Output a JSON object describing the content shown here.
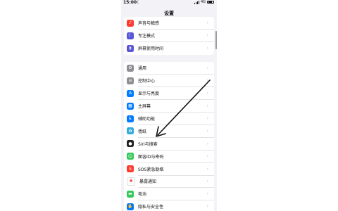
{
  "status_bar": {
    "time": "15:00",
    "network": "4G"
  },
  "nav": {
    "title": "设置"
  },
  "group1": [
    {
      "label": "声音与触感",
      "icon": "speaker-icon",
      "color": "#ff3b30"
    },
    {
      "label": "专注模式",
      "icon": "moon-icon",
      "color": "#5856d6"
    },
    {
      "label": "屏幕使用时间",
      "icon": "hourglass-icon",
      "color": "#5856d6"
    }
  ],
  "group2": [
    {
      "label": "通用",
      "icon": "gear-icon",
      "color": "#8e8e93"
    },
    {
      "label": "控制中心",
      "icon": "switches-icon",
      "color": "#8e8e93"
    },
    {
      "label": "显示与亮度",
      "icon": "text-size-icon",
      "color": "#007aff"
    },
    {
      "label": "主屏幕",
      "icon": "home-screen-icon",
      "color": "#007aff"
    },
    {
      "label": "辅助功能",
      "icon": "accessibility-icon",
      "color": "#007aff"
    },
    {
      "label": "墙纸",
      "icon": "flower-icon",
      "color": "#34aadc"
    },
    {
      "label": "Siri与搜索",
      "icon": "siri-icon",
      "color": "#222222"
    },
    {
      "label": "面容ID与密码",
      "icon": "face-id-icon",
      "color": "#34c759"
    },
    {
      "label": "SOS紧急联络",
      "icon": "sos-icon",
      "color": "#ff3b30"
    },
    {
      "label": "暴露通知",
      "icon": "exposure-icon",
      "color": "#ffffff"
    },
    {
      "label": "电池",
      "icon": "battery-icon",
      "color": "#34c759"
    },
    {
      "label": "隐私与安全性",
      "icon": "hand-icon",
      "color": "#007aff"
    }
  ],
  "chevron": "›",
  "annotation_color": "#111111"
}
